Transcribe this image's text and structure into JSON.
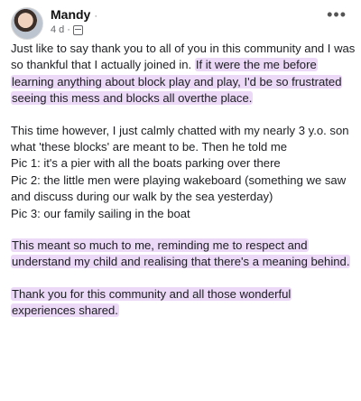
{
  "post": {
    "author": "Mandy",
    "author_suffix": "·",
    "time": "4 d",
    "time_separator": "·",
    "audience_icon": "privacy-icon",
    "more_icon": "more-options-icon",
    "p1_plain": "Just like to say thank you to all of you in this community and I was so thankful that I actually joined in. ",
    "p1_highlight": "If it were the me before learning anything about block play and play, I'd be so frustrated seeing this mess and blocks all overthe place.",
    "p2": "This time however, I just calmly chatted with my nearly 3 y.o. son what 'these blocks' are meant to be. Then he told me",
    "pic1": "Pic 1: it's a pier with all the boats parking over there",
    "pic2": "Pic 2: the little men were playing wakeboard (something we saw and discuss during our walk by the sea yesterday)",
    "pic3": "Pic 3: our family sailing in the boat",
    "p3": "This meant so much to me, reminding me to respect and understand my child and realising that there's a meaning behind.",
    "p4": "Thank you for this community and all those wonderful experiences shared."
  },
  "colors": {
    "highlight": "#ecd8f7",
    "text": "#1c1e21",
    "meta": "#65676b"
  }
}
